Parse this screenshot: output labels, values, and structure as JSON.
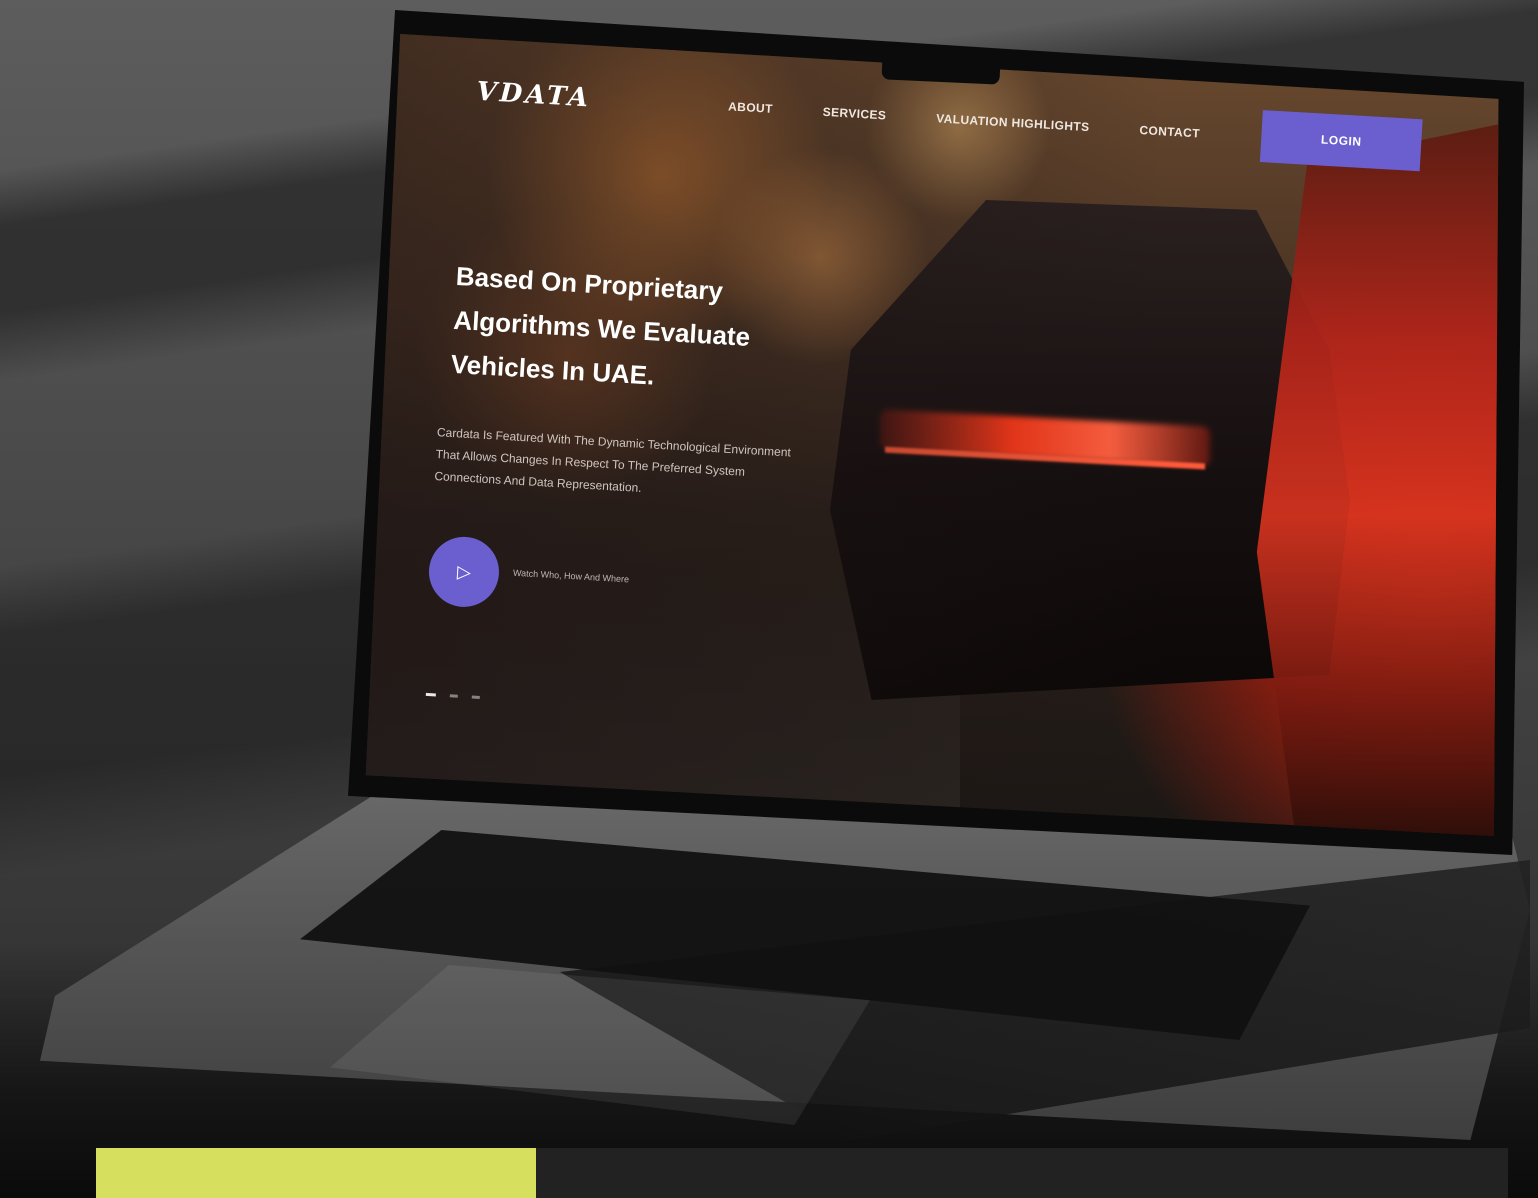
{
  "site": {
    "logo": "VDATA",
    "nav": [
      "ABOUT",
      "SERVICES",
      "VALUATION HIGHLIGHTS",
      "CONTACT"
    ],
    "login_label": "LOGIN",
    "headline": "Based On Proprietary Algorithms We Evaluate Vehicles In UAE.",
    "description": "Cardata Is Featured With The Dynamic Technological Environment That Allows Changes In Respect To The Preferred System Connections And Data Representation.",
    "play_label": "Watch Who, How And Where"
  },
  "slider": {
    "count": 3,
    "active": 1
  },
  "colors": {
    "accent": "#6b5fd0",
    "lime_block": "#d6e05e",
    "tail_light": "#ff3a1a"
  }
}
